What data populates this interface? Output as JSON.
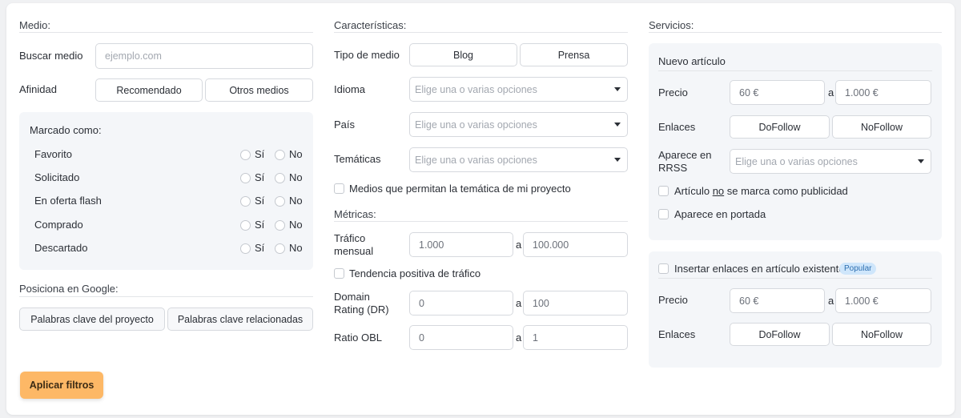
{
  "medio": {
    "section_title": "Medio:",
    "buscar_label": "Buscar medio",
    "buscar_placeholder": "ejemplo.com",
    "afinidad_label": "Afinidad",
    "afinidad_options": [
      "Recomendado",
      "Otros medios"
    ],
    "marcado": {
      "title": "Marcado como:",
      "yes_label": "Sí",
      "no_label": "No",
      "rows": [
        "Favorito",
        "Solicitado",
        "En oferta flash",
        "Comprado",
        "Descartado"
      ]
    },
    "google": {
      "section_title": "Posiciona en Google:",
      "buttons": [
        "Palabras clave del proyecto",
        "Palabras clave relacionadas"
      ]
    },
    "apply_label": "Aplicar filtros"
  },
  "caracteristicas": {
    "section_title": "Características:",
    "tipo_label": "Tipo de medio",
    "tipo_options": [
      "Blog",
      "Prensa"
    ],
    "idioma_label": "Idioma",
    "pais_label": "País",
    "tematicas_label": "Temáticas",
    "select_placeholder": "Elige una o varias opciones",
    "tematica_checkbox": "Medios que permitan la temática de mi proyecto"
  },
  "metricas": {
    "section_title": "Métricas:",
    "trafico_label_1": "Tráfico",
    "trafico_label_2": "mensual",
    "trafico_from": "1.000",
    "trafico_to": "100.000",
    "tendencia_checkbox": "Tendencia positiva de tráfico",
    "dr_label_1": "Domain",
    "dr_label_2": "Rating (DR)",
    "dr_from": "0",
    "dr_to": "100",
    "obl_label": "Ratio OBL",
    "obl_from": "0",
    "obl_to": "1",
    "range_sep": "a"
  },
  "servicios": {
    "section_title": "Servicios:",
    "nuevo": {
      "title": "Nuevo artículo",
      "precio_label": "Precio",
      "precio_from": "60 €",
      "precio_to": "1.000 €",
      "enlaces_label": "Enlaces",
      "enlaces_options": [
        "DoFollow",
        "NoFollow"
      ],
      "rrss_label_1": "Aparece en",
      "rrss_label_2": "RRSS",
      "rrss_placeholder": "Elige una o varias opciones",
      "publicidad_pre": "Artículo ",
      "publicidad_no": "no",
      "publicidad_post": " se marca como publicidad",
      "portada_label": "Aparece en portada"
    },
    "existente": {
      "checkbox_label": "Insertar enlaces en artículo existente",
      "badge": "Popular",
      "precio_label": "Precio",
      "precio_from": "60 €",
      "precio_to": "1.000 €",
      "enlaces_label": "Enlaces",
      "enlaces_options": [
        "DoFollow",
        "NoFollow"
      ]
    }
  }
}
